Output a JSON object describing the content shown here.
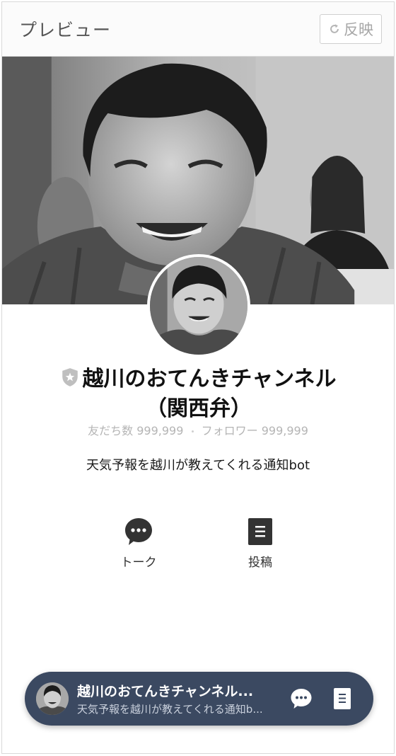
{
  "header": {
    "title": "プレビュー",
    "reflect_label": "反映"
  },
  "profile": {
    "name": "越川のおてんきチャンネル（関西弁）",
    "friends_label": "友だち数",
    "friends_count": "999,999",
    "followers_label": "フォロワー",
    "followers_count": "999,999",
    "description": "天気予報を越川が教えてくれる通知bot"
  },
  "actions": {
    "talk_label": "トーク",
    "post_label": "投稿"
  },
  "bottom_bar": {
    "name": "越川のおてんきチャンネル...",
    "description": "天気予報を越川が教えてくれる通知b..."
  },
  "colors": {
    "bar_bg": "#3b4961",
    "icon_dark": "#333333",
    "badge_gray": "#bfbfbf"
  }
}
